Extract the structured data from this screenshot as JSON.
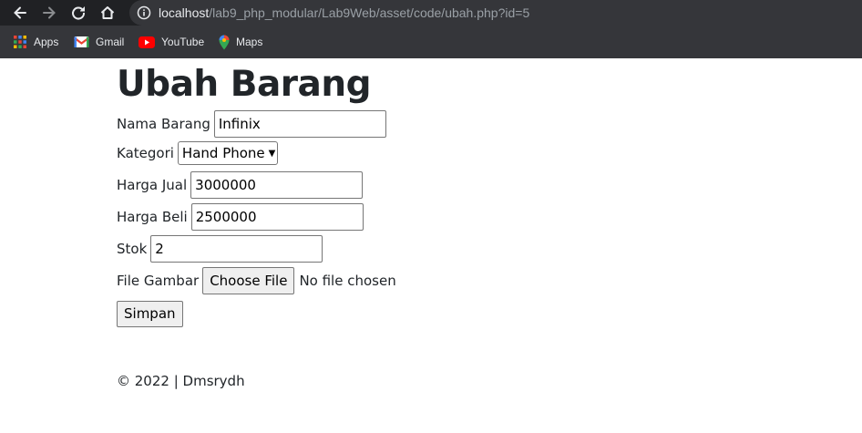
{
  "browser": {
    "url_host": "localhost",
    "url_path": "/lab9_php_modular/Lab9Web/asset/code/ubah.php?id=5",
    "bookmarks": [
      {
        "label": "Apps",
        "icon": "apps-grid-icon"
      },
      {
        "label": "Gmail",
        "icon": "gmail-icon"
      },
      {
        "label": "YouTube",
        "icon": "youtube-icon"
      },
      {
        "label": "Maps",
        "icon": "maps-pin-icon"
      }
    ]
  },
  "page": {
    "title": "Ubah Barang",
    "form": {
      "nama_label": "Nama Barang",
      "nama_value": "Infinix",
      "kategori_label": "Kategori",
      "kategori_selected": "Hand Phone",
      "harga_jual_label": "Harga Jual",
      "harga_jual_value": "3000000",
      "harga_beli_label": "Harga Beli",
      "harga_beli_value": "2500000",
      "stok_label": "Stok",
      "stok_value": "2",
      "gambar_label": "File Gambar",
      "file_button": "Choose File",
      "file_status": "No file chosen",
      "submit_label": "Simpan"
    },
    "footer": "© 2022 | Dmsrydh"
  }
}
